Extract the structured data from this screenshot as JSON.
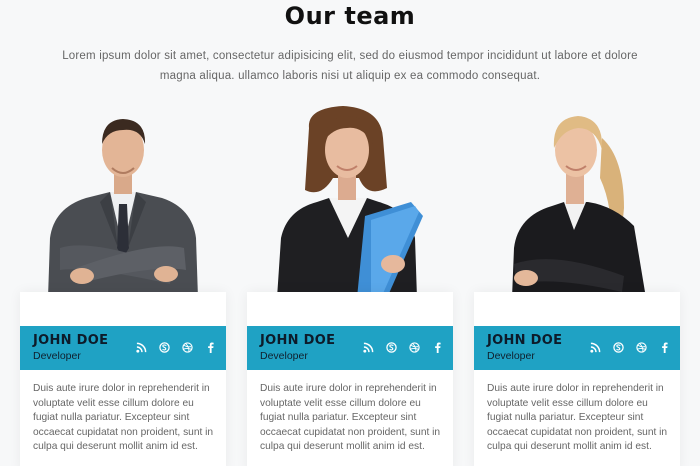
{
  "heading": "Our team",
  "description": "Lorem ipsum dolor sit amet, consectetur adipisicing elit, sed do eiusmod tempor incididunt ut labore et dolore magna aliqua. ullamco laboris nisi ut aliquip ex ea commodo consequat.",
  "accent_color": "#1fa2c4",
  "members": [
    {
      "name": "JOHN DOE",
      "role": "Developer",
      "bio": "Duis aute irure dolor in reprehenderit in voluptate velit esse cillum dolore eu fugiat nulla pariatur. Excepteur sint occaecat cupidatat non proident, sunt in culpa qui deserunt mollit anim id est.",
      "photo": "man-in-grey-suit-photo"
    },
    {
      "name": "JOHN DOE",
      "role": "Developer",
      "bio": "Duis aute irure dolor in reprehenderit in voluptate velit esse cillum dolore eu fugiat nulla pariatur. Excepteur sint occaecat cupidatat non proident, sunt in culpa qui deserunt mollit anim id est.",
      "photo": "woman-with-blue-folder-photo"
    },
    {
      "name": "JOHN DOE",
      "role": "Developer",
      "bio": "Duis aute irure dolor in reprehenderit in voluptate velit esse cillum dolore eu fugiat nulla pariatur. Excepteur sint occaecat cupidatat non proident, sunt in culpa qui deserunt mollit anim id est.",
      "photo": "blonde-woman-in-black-blazer-photo"
    }
  ],
  "social_icons": [
    "rss-icon",
    "skype-icon",
    "dribbble-icon",
    "facebook-icon"
  ]
}
